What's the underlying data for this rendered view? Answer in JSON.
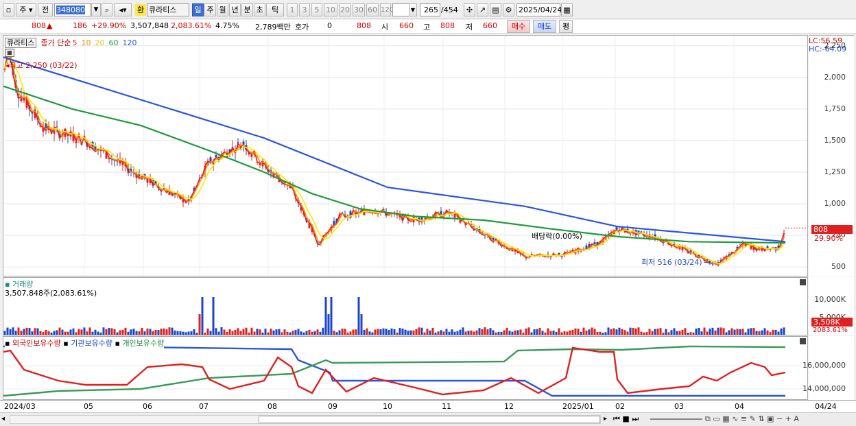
{
  "toolbar": {
    "market": "주",
    "prev": "전",
    "code": "348080",
    "name": "큐라티스",
    "exchange_badge": "환",
    "periods": [
      "일",
      "주",
      "월",
      "년",
      "분",
      "초",
      "틱"
    ],
    "minutes": [
      "1",
      "3",
      "5",
      "10",
      "20",
      "30",
      "60",
      "120"
    ],
    "count_value": "265",
    "count_total": "/454",
    "date": "2025/04/24"
  },
  "quote": {
    "price": "808",
    "arrow": "▲",
    "change": "186",
    "change_pct": "+29.90%",
    "volume": "3,507,848",
    "volume_pct": "2,083.61%",
    "turnover": "4.75%",
    "amount": "2,789백만",
    "hoga_label": "호가",
    "hoga_value": "0",
    "hoga_price": "808",
    "open_label": "시",
    "open": "660",
    "high_label": "고",
    "high": "808",
    "low_label": "저",
    "low": "660",
    "buy": "매수",
    "sell": "매도",
    "eval": "평"
  },
  "price_pane": {
    "title": "큐라티스",
    "ma_label": "종가 단순",
    "ma_periods": [
      "5",
      "10",
      "20",
      "60",
      "120"
    ],
    "ma_colors": [
      "#e02020",
      "#ff8a00",
      "#ffe600",
      "#1f9a3a",
      "#2a55e0"
    ],
    "high_note": "최고 2,250 (03/22)",
    "low_note": "최저 516 (03/24)",
    "div_note": "배당락(0.00%)",
    "lc": "LC:56.59",
    "hc": "HC:-64.09",
    "cur_tag": "808",
    "cur_pct": "29.90%",
    "yticks": [
      "2,250",
      "2,000",
      "1,750",
      "1,500",
      "1,250",
      "1,000",
      "750",
      "500"
    ]
  },
  "volume_pane": {
    "title": "거래량",
    "value": "3,507,848주(2,083.61%)",
    "yticks": [
      "10,000K",
      "5,000K"
    ],
    "tag": "3,508K",
    "tag_pct": "2083.61%"
  },
  "holding_pane": {
    "items": [
      "외국인보유수량",
      "기관보유수량",
      "개인보유수량"
    ],
    "yticks": [
      "16,000,000",
      "14,000,000"
    ]
  },
  "xaxis": {
    "dates": [
      "2024/03",
      "05",
      "06",
      "07",
      "08",
      "09",
      "10",
      "11",
      "12",
      "2025/01",
      "02",
      "03",
      "04"
    ],
    "last": "04/24"
  },
  "chart_data": {
    "type": "candlestick",
    "title": "큐라티스",
    "x_start": "2024/03/12",
    "x_end": "2025/04/24",
    "ylim": [
      430,
      2330
    ],
    "close_approx": [
      {
        "date": "2024/03/22",
        "value": 2250
      },
      {
        "date": "2024/05",
        "value": 1700
      },
      {
        "date": "2024/06",
        "value": 1450
      },
      {
        "date": "2024/07",
        "value": 1050
      },
      {
        "date": "2024/07/25",
        "value": 1470
      },
      {
        "date": "2024/08",
        "value": 1200
      },
      {
        "date": "2024/09",
        "value": 760
      },
      {
        "date": "2024/10",
        "value": 940
      },
      {
        "date": "2024/11",
        "value": 870
      },
      {
        "date": "2024/12",
        "value": 600
      },
      {
        "date": "2025/01",
        "value": 640
      },
      {
        "date": "2025/02",
        "value": 780
      },
      {
        "date": "2025/03",
        "value": 640
      },
      {
        "date": "2025/03/24",
        "value": 516
      },
      {
        "date": "2025/04",
        "value": 700
      },
      {
        "date": "2025/04/24",
        "value": 808
      }
    ],
    "ma120_approx": [
      {
        "date": "2024/03",
        "value": 2160
      },
      {
        "date": "2024/07",
        "value": 1520
      },
      {
        "date": "2024/10",
        "value": 1130
      },
      {
        "date": "2024/12",
        "value": 980
      },
      {
        "date": "2025/02",
        "value": 820
      },
      {
        "date": "2025/04/24",
        "value": 700
      }
    ],
    "volume_yticks": [
      "10,000K",
      "5,000K"
    ],
    "holding_series": [
      "외국인보유수량",
      "기관보유수량",
      "개인보유수량"
    ]
  }
}
